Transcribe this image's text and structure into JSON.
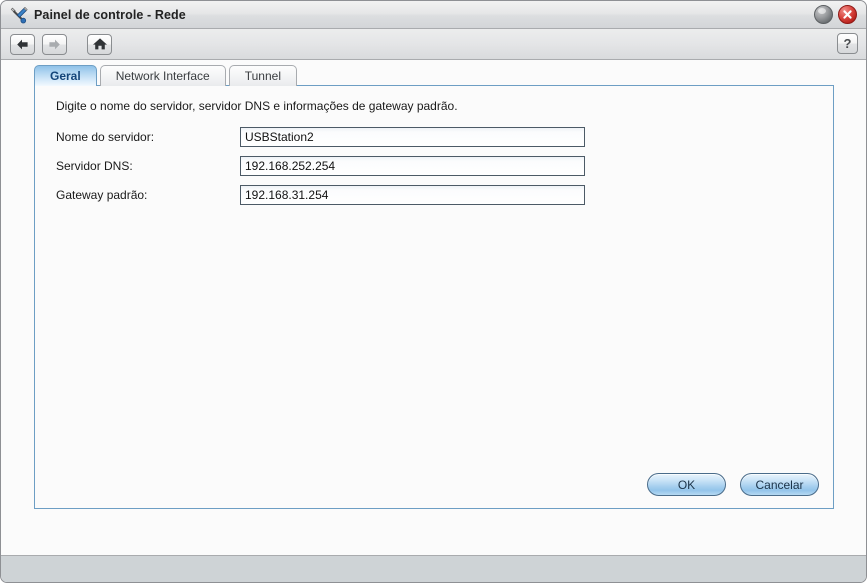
{
  "window": {
    "title": "Painel de controle - Rede",
    "icon": "tools-icon",
    "controls": {
      "minimize_label": "",
      "close_label": ""
    }
  },
  "toolbar": {
    "back_icon": "arrow-left-icon",
    "forward_icon": "arrow-right-icon",
    "home_icon": "home-icon",
    "help_label": "?"
  },
  "tabs": [
    {
      "label": "Geral",
      "active": true
    },
    {
      "label": "Network Interface",
      "active": false
    },
    {
      "label": "Tunnel",
      "active": false
    }
  ],
  "content": {
    "hint": "Digite o nome do servidor, servidor DNS e informações de gateway padrão.",
    "fields": [
      {
        "label": "Nome do servidor:",
        "value": "USBStation2",
        "placeholder": ""
      },
      {
        "label": "Servidor DNS:",
        "value": "192.168.252.254",
        "placeholder": ""
      },
      {
        "label": "Gateway padrão:",
        "value": "192.168.31.254",
        "placeholder": ""
      }
    ]
  },
  "buttons": {
    "ok": "OK",
    "cancel": "Cancelar"
  },
  "statusbar": {
    "text": ""
  },
  "colors": {
    "accent": "#6d9ec4",
    "tab_active_text": "#14457a",
    "close_button": "#d9453e",
    "button_blue": "#a8d0ef"
  }
}
